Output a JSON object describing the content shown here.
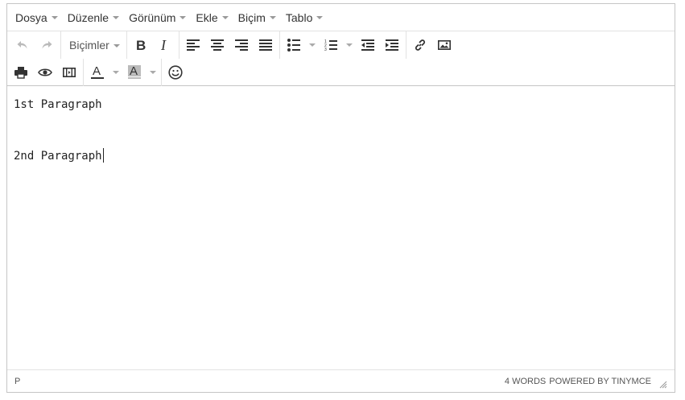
{
  "menubar": {
    "items": [
      "Dosya",
      "Düzenle",
      "Görünüm",
      "Ekle",
      "Biçim",
      "Tablo"
    ]
  },
  "toolbar": {
    "formats_label": "Biçimler",
    "buttons": [
      "undo-icon",
      "redo-icon",
      "bold-icon",
      "italic-icon",
      "align-left-icon",
      "align-center-icon",
      "align-right-icon",
      "align-justify-icon",
      "bullet-list-icon",
      "numbered-list-icon",
      "outdent-icon",
      "indent-icon",
      "link-icon",
      "image-icon",
      "print-icon",
      "preview-icon",
      "media-icon",
      "text-color-icon",
      "background-color-icon",
      "emoticons-icon"
    ],
    "text_color_glyph": "A",
    "bg_color_glyph": "A",
    "bold_glyph": "B",
    "italic_glyph": "I"
  },
  "content": {
    "paragraphs": [
      "1st Paragraph",
      "",
      "2nd Paragraph"
    ]
  },
  "statusbar": {
    "path": "P",
    "word_count": "4 WORDS",
    "powered_by": "POWERED BY TINYMCE"
  },
  "colors": {
    "border": "#c5c5c5",
    "icon": "#333333",
    "text_color_underline": "#333333",
    "bg_color_swatch": "#bbbbbb"
  }
}
